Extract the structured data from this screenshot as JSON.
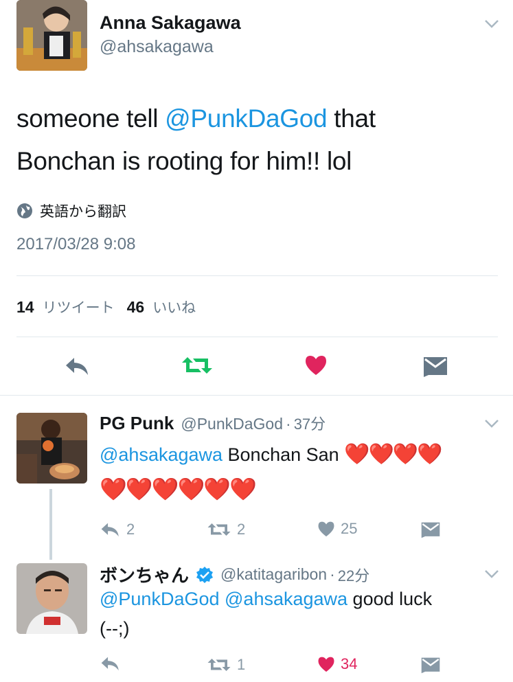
{
  "main_tweet": {
    "name": "Anna Sakagawa",
    "handle": "@ahsakagawa",
    "text_before": "someone tell ",
    "mention": "@PunkDaGod",
    "text_after_line1": " that",
    "text_line2": "Bonchan is rooting for him!! lol",
    "translate_label": "英語から翻訳",
    "timestamp": "2017/03/28 9:08",
    "retweet_count": "14",
    "retweet_label": "リツイート",
    "like_count": "46",
    "like_label": "いいね"
  },
  "replies": [
    {
      "name": "PG Punk",
      "handle": "@PunkDaGod",
      "time": "37分",
      "mention": "@ahsakagawa",
      "text": " Bonchan San ",
      "hearts_line1": "❤️❤️❤️❤️",
      "hearts_line2": "❤️❤️❤️❤️❤️❤️",
      "reply_count": "2",
      "retweet_count": "2",
      "like_count": "25"
    },
    {
      "name": "ボンちゃん",
      "handle": "@katitagaribon",
      "time": "22分",
      "mention1": "@PunkDaGod",
      "mention2": "@ahsakagawa",
      "text": " good luck",
      "text_line2": "(--;)",
      "retweet_count": "1",
      "like_count": "34"
    }
  ],
  "colors": {
    "link": "#1b95e0",
    "retweet_active": "#17bf63",
    "like_active": "#e0245e",
    "muted": "#657786",
    "icon_gray": "#8899a6"
  }
}
